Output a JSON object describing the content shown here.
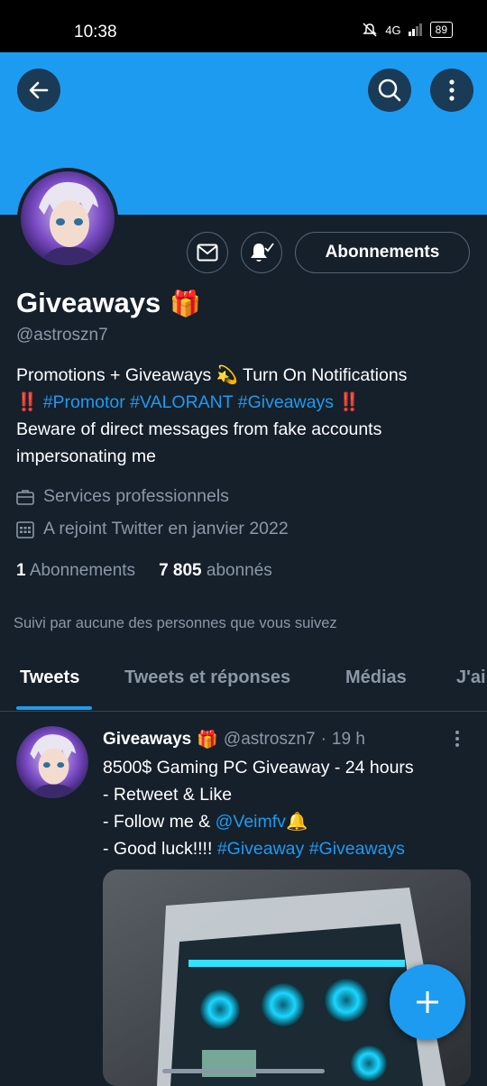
{
  "status_bar": {
    "time": "10:38",
    "network": "4G",
    "battery": "89"
  },
  "profile": {
    "name": "Giveaways",
    "name_emoji": "🎁",
    "handle": "@astroszn7",
    "follow_button_label": "Abonnements",
    "bio": {
      "line1_text": "Promotions + Giveaways",
      "line1_emoji": "💫",
      "line1_end": "Turn On Notifications",
      "mark_start": "‼️",
      "hashtags": [
        "#Promotor",
        "#VALORANT",
        "#Giveaways"
      ],
      "mark_end": "‼️",
      "line3": "Beware of direct messages from fake accounts impersonating me"
    },
    "category": "Services professionnels",
    "joined": "A rejoint Twitter en janvier 2022",
    "following_count": "1",
    "following_label": "Abonnements",
    "followers_count": "7 805",
    "followers_label": "abonnés",
    "followed_by_note": "Suivi par aucune des personnes que vous suivez"
  },
  "tabs": [
    {
      "label": "Tweets",
      "active": true
    },
    {
      "label": "Tweets et réponses",
      "active": false
    },
    {
      "label": "Médias",
      "active": false
    },
    {
      "label": "J'ai",
      "active": false
    }
  ],
  "tweet": {
    "author_name": "Giveaways",
    "author_emoji": "🎁",
    "author_handle": "@astroszn7",
    "separator": "·",
    "time": "19 h",
    "line1": "8500$ Gaming PC Giveaway - 24 hours",
    "line2": "- Retweet & Like",
    "line3_prefix": "- Follow me & ",
    "line3_mention": "@Veimfv",
    "line3_emoji": "🔔",
    "line4_prefix": "- Good luck!!!! ",
    "line4_tags": [
      "#Giveaway",
      "#Giveaways"
    ]
  },
  "icons": {
    "back": "arrow-left-icon",
    "search": "search-icon",
    "more": "more-vertical-icon",
    "message": "envelope-icon",
    "notifications": "bell-check-icon",
    "category": "briefcase-icon",
    "joined": "calendar-icon",
    "compose": "plus-icon"
  },
  "colors": {
    "accent": "#1d9bf0",
    "background": "#15202b",
    "muted": "#8b98a5",
    "alert": "#f4212e"
  }
}
